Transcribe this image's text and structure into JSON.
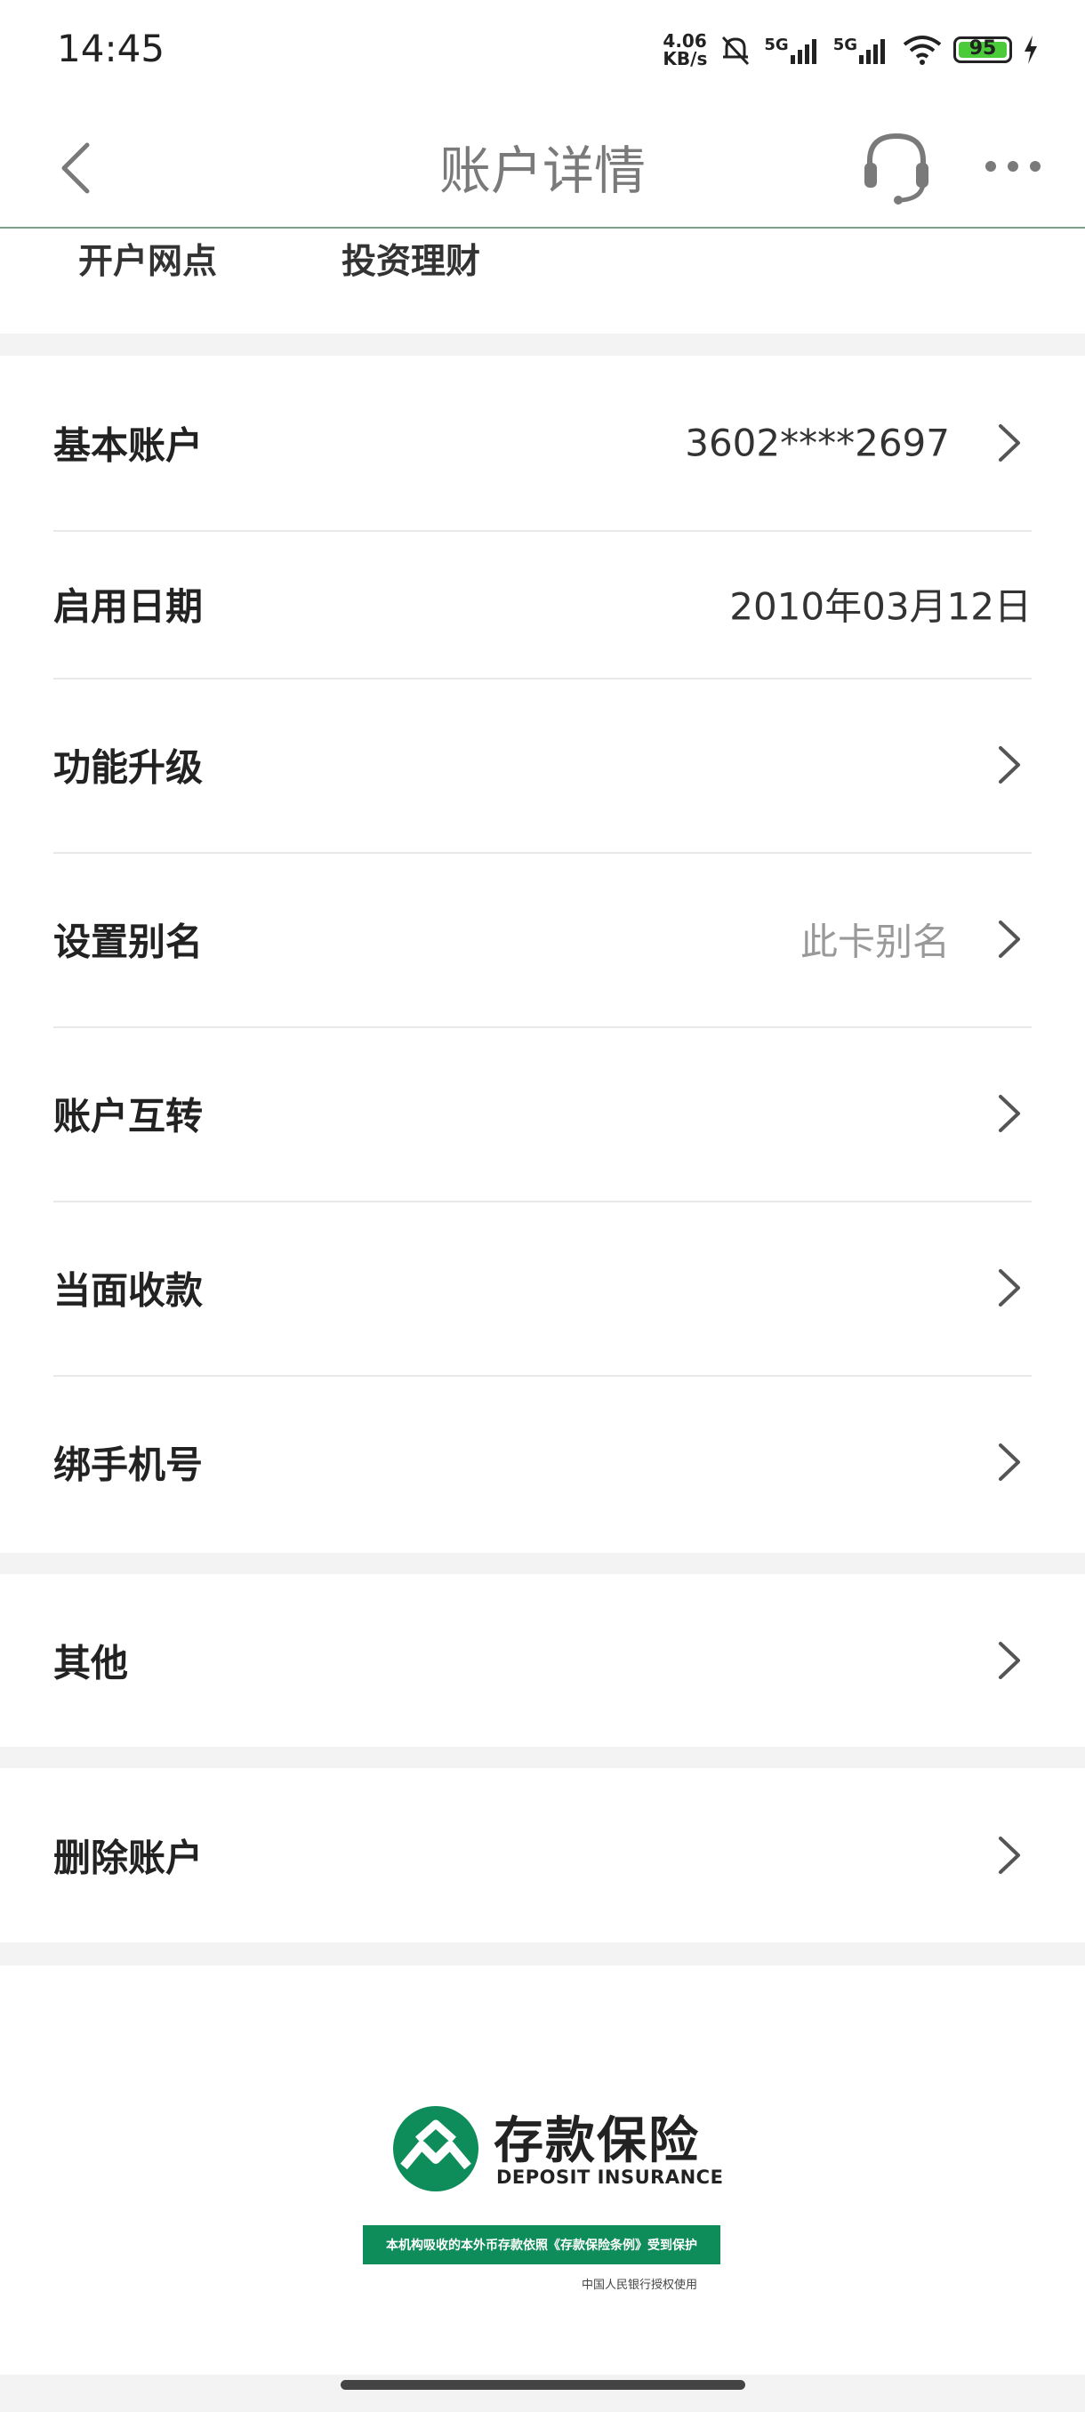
{
  "status_bar": {
    "time": "14:45",
    "speed_value": "4.06",
    "speed_unit": "KB/s",
    "net1": "5G",
    "net2": "5G",
    "battery": "95"
  },
  "nav": {
    "title": "账户详情"
  },
  "tabs": [
    "开户网点",
    "投资理财"
  ],
  "rows": [
    {
      "label": "基本账户",
      "value": "3602****2697"
    },
    {
      "label": "启用日期",
      "value": "2010年03月12日"
    },
    {
      "label": "功能升级",
      "value": ""
    },
    {
      "label": "设置别名",
      "value": "此卡别名"
    },
    {
      "label": "账户互转",
      "value": ""
    },
    {
      "label": "当面收款",
      "value": ""
    },
    {
      "label": "绑手机号",
      "value": ""
    }
  ],
  "other": {
    "label": "其他"
  },
  "delete": {
    "label": "删除账户"
  },
  "footer": {
    "logo_cn": "存款保险",
    "logo_en": "DEPOSIT INSURANCE",
    "banner": "本机构吸收的本外币存款依照《存款保险条例》受到保护",
    "authorized": "中国人民银行授权使用"
  },
  "colors": {
    "brand_green": "#0e8c5a",
    "divider": "#e8e8e8"
  }
}
